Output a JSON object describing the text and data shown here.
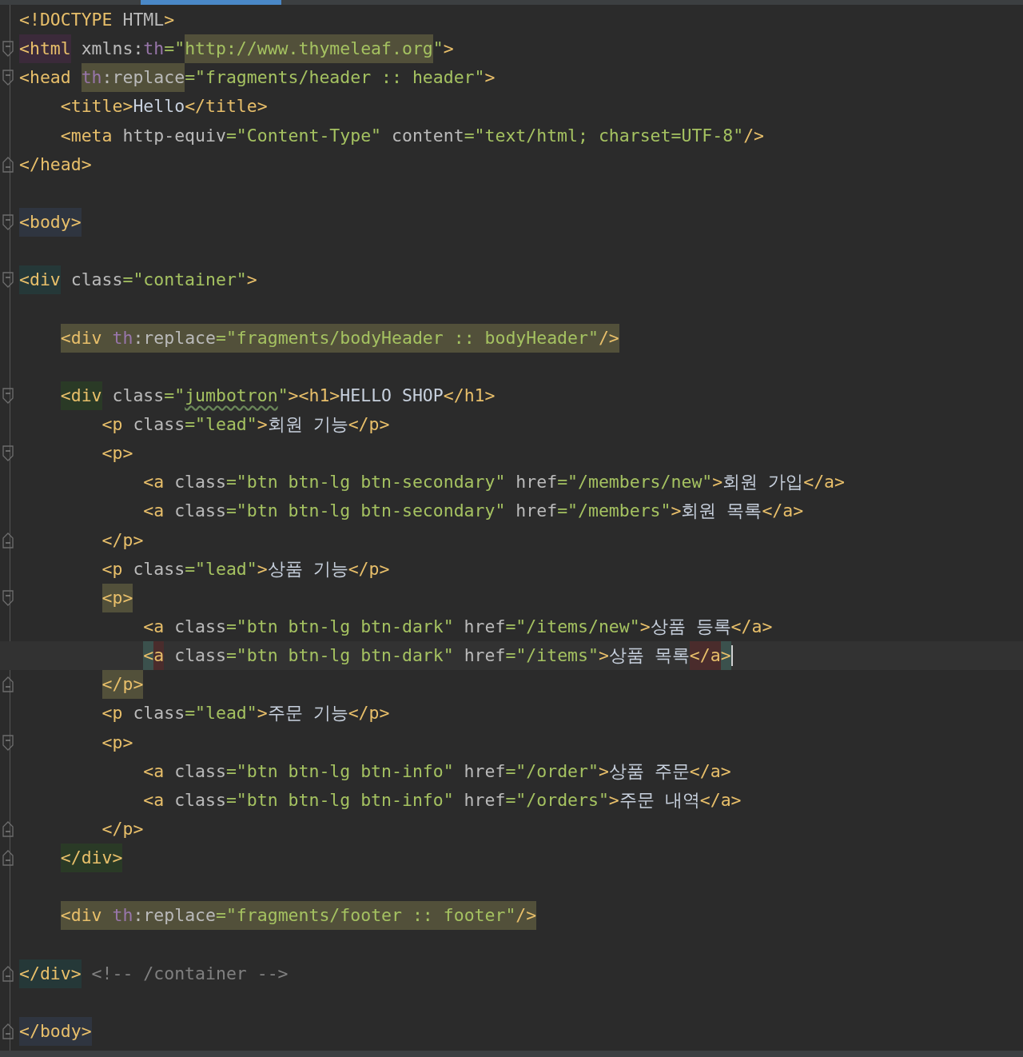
{
  "editor": {
    "lines": [
      {
        "kind": "plain",
        "current": false,
        "tokens": [
          {
            "text": "<!DOCTYPE",
            "kind": "tag"
          },
          {
            "text": " HTML",
            "kind": "attr"
          },
          {
            "text": ">",
            "kind": "tag"
          }
        ]
      },
      {
        "kind": "opener",
        "current": false,
        "tokens": [
          {
            "text": "<html",
            "kind": "tag",
            "color": "#3b2a3a"
          },
          {
            "text": " xmlns:",
            "kind": "attr"
          },
          {
            "text": "th",
            "kind": "ns"
          },
          {
            "text": "=\"",
            "kind": "val"
          },
          {
            "text": "http://www.thymeleaf.org",
            "kind": "val",
            "color": "#52503a"
          },
          {
            "text": "\"",
            "kind": "val"
          },
          {
            "text": ">",
            "kind": "tag"
          }
        ]
      },
      {
        "kind": "opener",
        "current": false,
        "tokens": [
          {
            "text": "<head ",
            "kind": "tag"
          },
          {
            "text": "th",
            "kind": "ns",
            "color": "#52503a"
          },
          {
            "text": ":replace",
            "kind": "attr",
            "color": "#52503a"
          },
          {
            "text": "=\"fragments/header :: header\"",
            "kind": "val"
          },
          {
            "text": ">",
            "kind": "tag"
          }
        ]
      },
      {
        "kind": "plain",
        "current": false,
        "tokens": [
          {
            "text": "    <title>",
            "kind": "tag"
          },
          {
            "text": "Hello",
            "kind": "text"
          },
          {
            "text": "</title>",
            "kind": "tag"
          }
        ]
      },
      {
        "kind": "plain",
        "current": false,
        "tokens": [
          {
            "text": "    <meta",
            "kind": "tag"
          },
          {
            "text": " http-equiv",
            "kind": "attr"
          },
          {
            "text": "=\"Content-Type\"",
            "kind": "val"
          },
          {
            "text": " content",
            "kind": "attr"
          },
          {
            "text": "=\"text/html; charset=UTF-8\"",
            "kind": "val"
          },
          {
            "text": "/>",
            "kind": "tag"
          }
        ]
      },
      {
        "kind": "closer",
        "current": false,
        "tokens": [
          {
            "text": "</head>",
            "kind": "tag"
          }
        ]
      },
      {
        "kind": "plain",
        "current": false
      },
      {
        "kind": "opener",
        "current": false,
        "tokens": [
          {
            "text": "<body>",
            "kind": "tag",
            "color": "#2f3540"
          }
        ]
      },
      {
        "kind": "plain",
        "current": false
      },
      {
        "kind": "opener",
        "current": false,
        "tokens": [
          {
            "text": "<div",
            "kind": "tag",
            "color": "#253838"
          },
          {
            "text": " class",
            "kind": "attr"
          },
          {
            "text": "=\"container\"",
            "kind": "val"
          },
          {
            "text": ">",
            "kind": "tag"
          }
        ]
      },
      {
        "kind": "plain",
        "current": false
      },
      {
        "kind": "plain",
        "current": false,
        "tokens": [
          {
            "text": "    <div ",
            "kind": "tag",
            "color": "#52503a"
          },
          {
            "text": "th",
            "kind": "ns",
            "color": "#52503a"
          },
          {
            "text": ":replace",
            "kind": "attr",
            "color": "#52503a"
          },
          {
            "text": "=\"fragments/bodyHeader :: bodyHeader\"",
            "kind": "val",
            "color": "#52503a"
          },
          {
            "text": "/>",
            "kind": "tag",
            "color": "#52503a"
          }
        ]
      },
      {
        "kind": "plain",
        "current": false
      },
      {
        "kind": "opener",
        "current": false,
        "tokens": [
          {
            "text": "    <div",
            "kind": "tag",
            "color": "#2a3a26"
          },
          {
            "text": " class",
            "kind": "attr"
          },
          {
            "text": "=\"",
            "kind": "val"
          },
          {
            "text": "jumbotron",
            "kind": "val",
            "misspelled": true
          },
          {
            "text": "\"",
            "kind": "val"
          },
          {
            "text": "><h1>",
            "kind": "tag"
          },
          {
            "text": "HELLO SHOP",
            "kind": "text"
          },
          {
            "text": "</h1>",
            "kind": "tag"
          }
        ]
      },
      {
        "kind": "plain",
        "current": false,
        "tokens": [
          {
            "text": "        <p",
            "kind": "tag"
          },
          {
            "text": " class",
            "kind": "attr"
          },
          {
            "text": "=\"lead\"",
            "kind": "val"
          },
          {
            "text": ">",
            "kind": "tag"
          },
          {
            "text": "회원 기능",
            "kind": "text"
          },
          {
            "text": "</p>",
            "kind": "tag"
          }
        ]
      },
      {
        "kind": "opener",
        "current": false,
        "tokens": [
          {
            "text": "        <p>",
            "kind": "tag"
          }
        ]
      },
      {
        "kind": "plain",
        "current": false,
        "tokens": [
          {
            "text": "            <a",
            "kind": "tag"
          },
          {
            "text": " class",
            "kind": "attr"
          },
          {
            "text": "=\"btn btn-lg btn-secondary\"",
            "kind": "val"
          },
          {
            "text": " href",
            "kind": "attr"
          },
          {
            "text": "=\"/members/new\"",
            "kind": "val"
          },
          {
            "text": ">",
            "kind": "tag"
          },
          {
            "text": "회원 가입",
            "kind": "text"
          },
          {
            "text": "</a>",
            "kind": "tag"
          }
        ]
      },
      {
        "kind": "plain",
        "current": false,
        "tokens": [
          {
            "text": "            <a",
            "kind": "tag"
          },
          {
            "text": " class",
            "kind": "attr"
          },
          {
            "text": "=\"btn btn-lg btn-secondary\"",
            "kind": "val"
          },
          {
            "text": " href",
            "kind": "attr"
          },
          {
            "text": "=\"/members\"",
            "kind": "val"
          },
          {
            "text": ">",
            "kind": "tag"
          },
          {
            "text": "회원 목록",
            "kind": "text"
          },
          {
            "text": "</a>",
            "kind": "tag"
          }
        ]
      },
      {
        "kind": "closer",
        "current": false,
        "tokens": [
          {
            "text": "        </p>",
            "kind": "tag"
          }
        ]
      },
      {
        "kind": "plain",
        "current": false,
        "tokens": [
          {
            "text": "        <p",
            "kind": "tag"
          },
          {
            "text": " class",
            "kind": "attr"
          },
          {
            "text": "=\"lead\"",
            "kind": "val"
          },
          {
            "text": ">",
            "kind": "tag"
          },
          {
            "text": "상품 기능",
            "kind": "text"
          },
          {
            "text": "</p>",
            "kind": "tag"
          }
        ]
      },
      {
        "kind": "opener",
        "current": false,
        "tokens": [
          {
            "text": "        <p>",
            "kind": "tag",
            "color": "#52503a"
          }
        ]
      },
      {
        "kind": "plain",
        "current": false,
        "tokens": [
          {
            "text": "            <a",
            "kind": "tag"
          },
          {
            "text": " class",
            "kind": "attr"
          },
          {
            "text": "=\"btn btn-lg btn-dark\"",
            "kind": "val"
          },
          {
            "text": " href",
            "kind": "attr"
          },
          {
            "text": "=\"/items/new\"",
            "kind": "val"
          },
          {
            "text": ">",
            "kind": "tag"
          },
          {
            "text": "상품 등록",
            "kind": "text"
          },
          {
            "text": "</a>",
            "kind": "tag"
          }
        ]
      },
      {
        "kind": "plain",
        "current": true,
        "tokens": [
          {
            "text": "            <",
            "kind": "tag",
            "color": "#3b514d"
          },
          {
            "text": "a",
            "kind": "tag",
            "color": "#4a2c2c"
          },
          {
            "text": " class",
            "kind": "attr"
          },
          {
            "text": "=\"btn btn-lg btn-dark\"",
            "kind": "val"
          },
          {
            "text": " href",
            "kind": "attr"
          },
          {
            "text": "=\"/items\"",
            "kind": "val"
          },
          {
            "text": ">",
            "kind": "tag"
          },
          {
            "text": "상품 목록",
            "kind": "text"
          },
          {
            "text": "</a",
            "kind": "tag",
            "color": "#4a2c2c"
          },
          {
            "text": ">",
            "kind": "tag",
            "color": "#3b514d"
          }
        ]
      },
      {
        "kind": "closer",
        "current": false,
        "tokens": [
          {
            "text": "        </p>",
            "kind": "tag",
            "color": "#52503a"
          }
        ]
      },
      {
        "kind": "plain",
        "current": false,
        "tokens": [
          {
            "text": "        <p",
            "kind": "tag"
          },
          {
            "text": " class",
            "kind": "attr"
          },
          {
            "text": "=\"lead\"",
            "kind": "val"
          },
          {
            "text": ">",
            "kind": "tag"
          },
          {
            "text": "주문 기능",
            "kind": "text"
          },
          {
            "text": "</p>",
            "kind": "tag"
          }
        ]
      },
      {
        "kind": "opener",
        "current": false,
        "tokens": [
          {
            "text": "        <p>",
            "kind": "tag"
          }
        ]
      },
      {
        "kind": "plain",
        "current": false,
        "tokens": [
          {
            "text": "            <a",
            "kind": "tag"
          },
          {
            "text": " class",
            "kind": "attr"
          },
          {
            "text": "=\"btn btn-lg btn-info\"",
            "kind": "val"
          },
          {
            "text": " href",
            "kind": "attr"
          },
          {
            "text": "=\"/order\"",
            "kind": "val"
          },
          {
            "text": ">",
            "kind": "tag"
          },
          {
            "text": "상품 주문",
            "kind": "text"
          },
          {
            "text": "</a>",
            "kind": "tag"
          }
        ]
      },
      {
        "kind": "plain",
        "current": false,
        "tokens": [
          {
            "text": "            <a",
            "kind": "tag"
          },
          {
            "text": " class",
            "kind": "attr"
          },
          {
            "text": "=\"btn btn-lg btn-info\"",
            "kind": "val"
          },
          {
            "text": " href",
            "kind": "attr"
          },
          {
            "text": "=\"/orders\"",
            "kind": "val"
          },
          {
            "text": ">",
            "kind": "tag"
          },
          {
            "text": "주문 내역",
            "kind": "text"
          },
          {
            "text": "</a>",
            "kind": "tag"
          }
        ]
      },
      {
        "kind": "closer",
        "current": false,
        "tokens": [
          {
            "text": "        </p>",
            "kind": "tag"
          }
        ]
      },
      {
        "kind": "closer",
        "current": false,
        "tokens": [
          {
            "text": "    </div>",
            "kind": "tag",
            "color": "#2a3a26"
          }
        ]
      },
      {
        "kind": "plain",
        "current": false
      },
      {
        "kind": "plain",
        "current": false,
        "tokens": [
          {
            "text": "    <div ",
            "kind": "tag",
            "color": "#52503a"
          },
          {
            "text": "th",
            "kind": "ns",
            "color": "#52503a"
          },
          {
            "text": ":replace",
            "kind": "attr",
            "color": "#52503a"
          },
          {
            "text": "=\"fragments/footer :: footer\"",
            "kind": "val",
            "color": "#52503a"
          },
          {
            "text": "/>",
            "kind": "tag",
            "color": "#52503a"
          }
        ]
      },
      {
        "kind": "plain",
        "current": false
      },
      {
        "kind": "closer",
        "current": false,
        "tokens": [
          {
            "text": "</div>",
            "kind": "tag",
            "color": "#253838"
          },
          {
            "text": " <!-- /container -->",
            "kind": "comment"
          }
        ]
      },
      {
        "kind": "plain",
        "current": false
      },
      {
        "kind": "closer",
        "current": false,
        "tokens": [
          {
            "text": "</body>",
            "kind": "tag",
            "color": "#2f3540"
          }
        ]
      }
    ]
  }
}
